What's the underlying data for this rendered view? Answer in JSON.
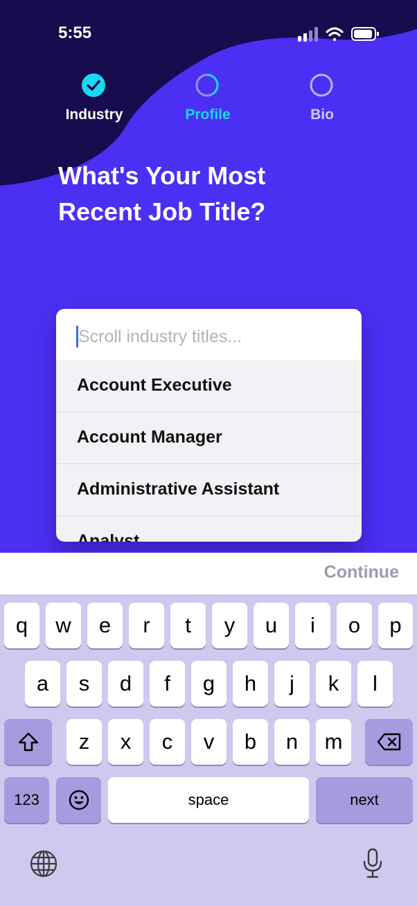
{
  "status": {
    "time": "5:55"
  },
  "steps": [
    {
      "label": "Industry",
      "state": "done"
    },
    {
      "label": "Profile",
      "state": "active"
    },
    {
      "label": "Bio",
      "state": "pending"
    }
  ],
  "title": {
    "line1": "What's Your Most",
    "line2": "Recent Job Title?"
  },
  "search": {
    "placeholder": "Scroll industry titles..."
  },
  "options": [
    "Account Executive",
    "Account Manager",
    "Administrative Assistant",
    "Analyst"
  ],
  "footer": {
    "continue": "Continue"
  },
  "keyboard": {
    "row1": [
      "q",
      "w",
      "e",
      "r",
      "t",
      "y",
      "u",
      "i",
      "o",
      "p"
    ],
    "row2": [
      "a",
      "s",
      "d",
      "f",
      "g",
      "h",
      "j",
      "k",
      "l"
    ],
    "row3": [
      "z",
      "x",
      "c",
      "v",
      "b",
      "n",
      "m"
    ],
    "numbers": "123",
    "space": "space",
    "next": "next"
  },
  "colors": {
    "primary": "#4b2ff2",
    "dark_wave": "#170c4d",
    "accent": "#17d9f0",
    "inactive": "#b9b3e8"
  }
}
